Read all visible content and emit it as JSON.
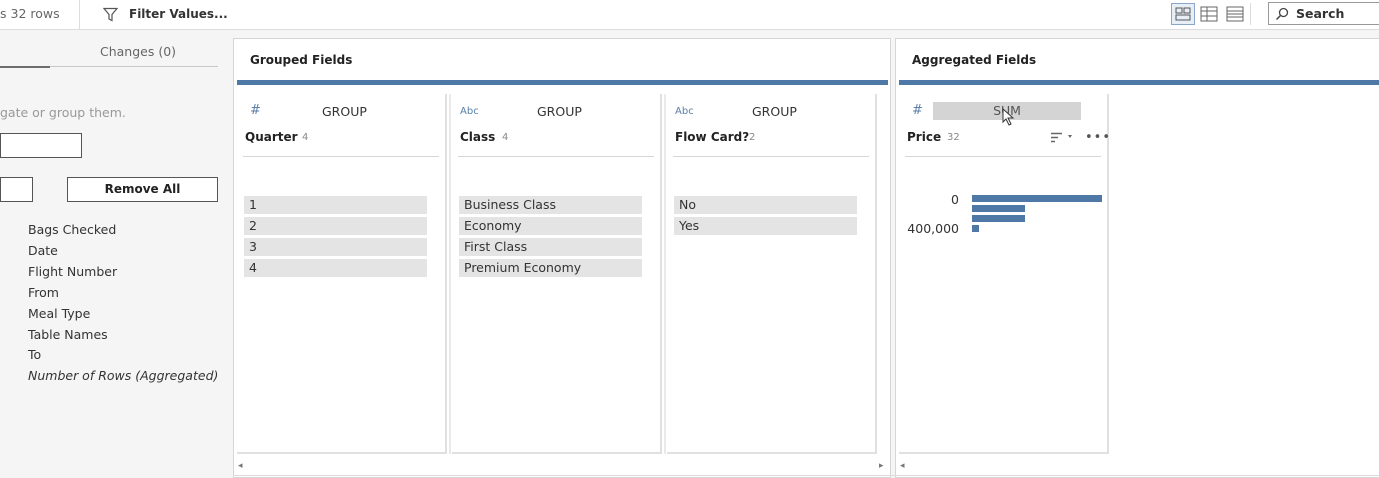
{
  "toolbar": {
    "rows_text": "s  32 rows",
    "filter_label": "Filter Values...",
    "search_label": "Search",
    "icons": [
      "filter-icon",
      "card-view-icon",
      "table-view-icon",
      "list-view-icon",
      "search-icon"
    ]
  },
  "left_panel": {
    "changes_tab": "Changes (0)",
    "hint": "gate or group them.",
    "remove_all": "Remove All",
    "fields": [
      "Bags Checked",
      "Date",
      "Flight Number",
      "From",
      "Meal Type",
      "Table Names",
      "To",
      "Number of Rows (Aggregated)"
    ]
  },
  "grouped": {
    "title": "Grouped Fields",
    "cards": [
      {
        "type": "#",
        "agg": "GROUP",
        "name": "Quarter",
        "count": "4",
        "values": [
          "1",
          "2",
          "3",
          "4"
        ]
      },
      {
        "type": "Abc",
        "agg": "GROUP",
        "name": "Class",
        "count": "4",
        "values": [
          "Business Class",
          "Economy",
          "First Class",
          "Premium Economy"
        ]
      },
      {
        "type": "Abc",
        "agg": "GROUP",
        "name": "Flow Card?",
        "count": "2",
        "values": [
          "No",
          "Yes"
        ]
      }
    ]
  },
  "aggregated": {
    "title": "Aggregated Fields",
    "card": {
      "type": "#",
      "agg": "SUM",
      "name": "Price",
      "count": "32",
      "axis_labels": [
        "0",
        "400,000"
      ],
      "histogram_fractions": [
        1.0,
        0.41,
        0.41,
        0.05
      ]
    }
  },
  "colors": {
    "accent": "#4e79a7",
    "value_bg": "#e4e4e4"
  }
}
